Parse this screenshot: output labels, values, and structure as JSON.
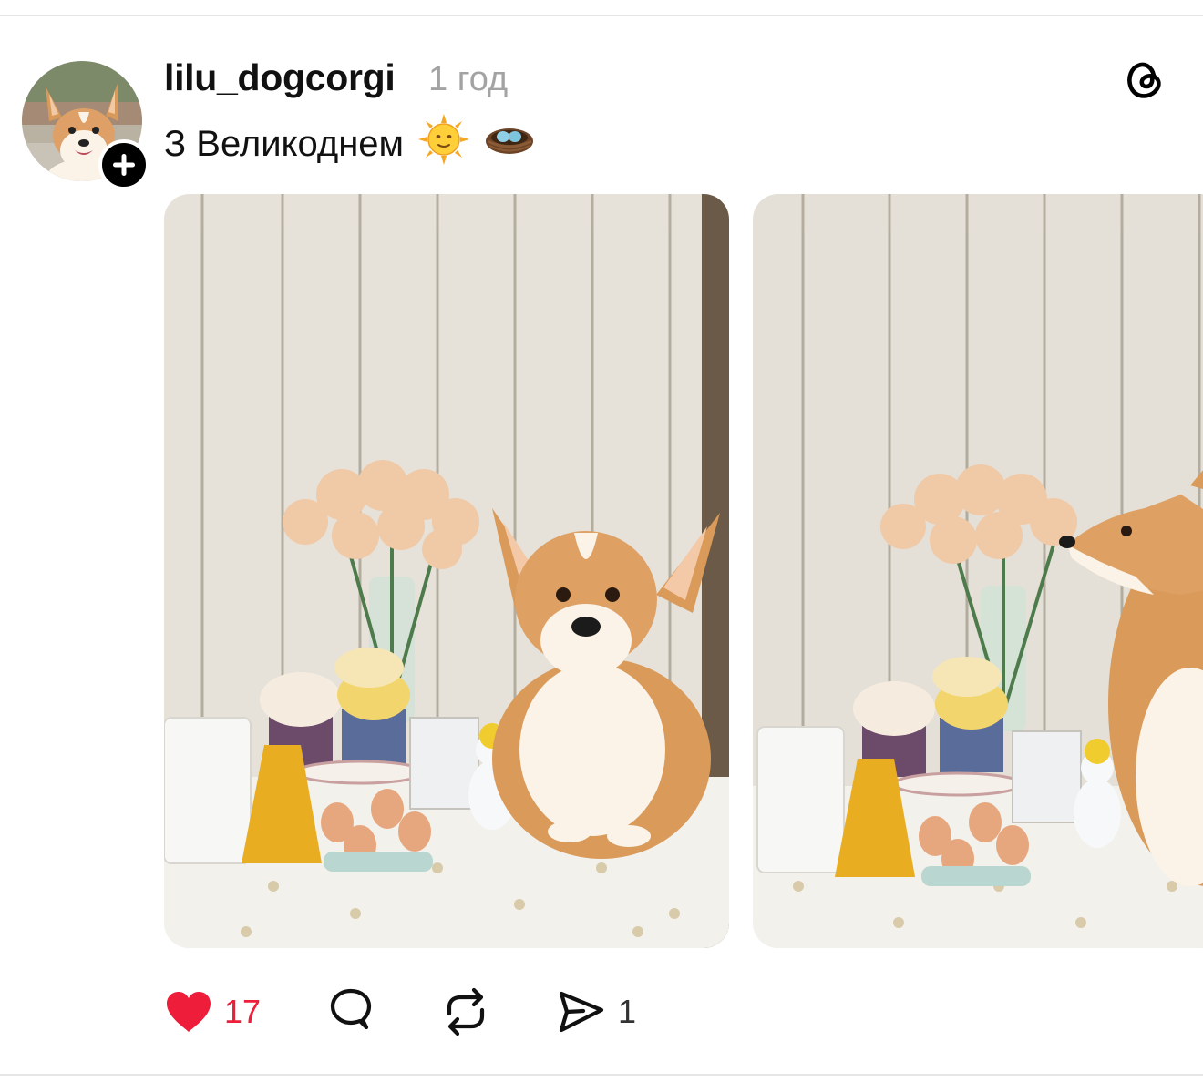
{
  "post": {
    "username": "lilu_dogcorgi",
    "time": "1 год",
    "caption_text": "З Великоднем",
    "caption_emojis": [
      "sun-face-emoji",
      "nest-with-eggs-emoji"
    ],
    "app_icon": "threads-icon"
  },
  "media": {
    "images": [
      {
        "icon": "photo-corgi-easter-table-front"
      },
      {
        "icon": "photo-corgi-sniffing-flowers"
      }
    ]
  },
  "actions": {
    "like": {
      "icon": "heart-filled-icon",
      "count": "17",
      "liked": true,
      "color": "#ee1d3a"
    },
    "comment": {
      "icon": "comment-bubble-icon"
    },
    "repost": {
      "icon": "repost-icon"
    },
    "share": {
      "icon": "send-icon",
      "count": "1"
    }
  }
}
